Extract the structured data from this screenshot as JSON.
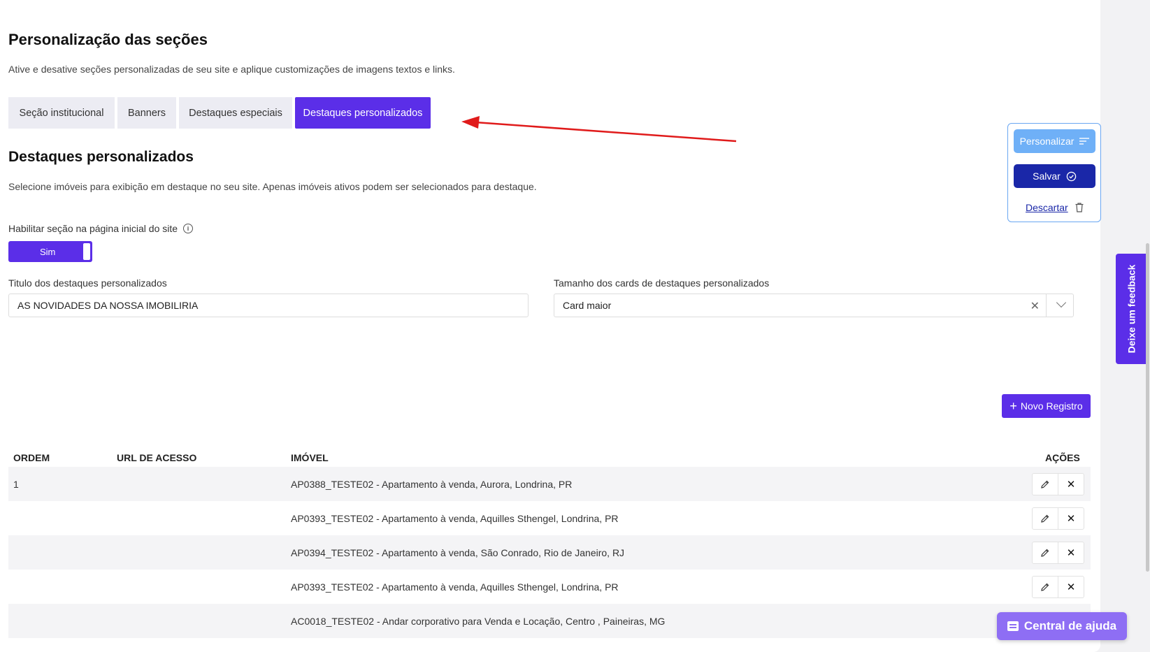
{
  "header": {
    "title": "Personalização das seções",
    "subtitle": "Ative e desative seções personalizadas de seu site e aplique customizações de imagens textos e links."
  },
  "tabs": [
    {
      "label": "Seção institucional"
    },
    {
      "label": "Banners"
    },
    {
      "label": "Destaques especiais"
    },
    {
      "label": "Destaques personalizados",
      "active": true
    }
  ],
  "section": {
    "title": "Destaques personalizados",
    "subtitle": "Selecione imóveis para exibição em destaque no seu site. Apenas imóveis ativos podem ser selecionados para destaque."
  },
  "enable": {
    "label": "Habilitar seção na página inicial do site",
    "toggle_label": "Sim"
  },
  "fields": {
    "title_label": "Titulo dos destaques personalizados",
    "title_value": "AS NOVIDADES DA NOSSA IMOBILIRIA",
    "size_label": "Tamanho dos cards de destaques personalizados",
    "size_value": "Card maior"
  },
  "floating": {
    "personalizar": "Personalizar",
    "salvar": "Salvar",
    "descartar": "Descartar"
  },
  "feedback_label": "Deixe um feedback",
  "new_record": "Novo Registro",
  "table": {
    "headers": {
      "order": "ORDEM",
      "url": "URL DE ACESSO",
      "property": "IMÓVEL",
      "actions": "AÇÕES"
    },
    "rows": [
      {
        "order": "1",
        "url": "",
        "property": "AP0388_TESTE02 - Apartamento à venda, Aurora, Londrina, PR"
      },
      {
        "order": "",
        "url": "",
        "property": "AP0393_TESTE02 - Apartamento à venda, Aquilles Sthengel, Londrina, PR"
      },
      {
        "order": "",
        "url": "",
        "property": "AP0394_TESTE02 - Apartamento à venda, São Conrado, Rio de Janeiro, RJ"
      },
      {
        "order": "",
        "url": "",
        "property": "AP0393_TESTE02 - Apartamento à venda, Aquilles Sthengel, Londrina, PR"
      },
      {
        "order": "",
        "url": "",
        "property": "AC0018_TESTE02 - Andar corporativo para Venda e Locação, Centro , Paineiras, MG"
      }
    ]
  },
  "help_label": "Central de ajuda",
  "colors": {
    "primary": "#5b2ee8",
    "dark_blue": "#1a27a8",
    "light_blue": "#6fb0f7",
    "arrow": "#e01b1b"
  }
}
